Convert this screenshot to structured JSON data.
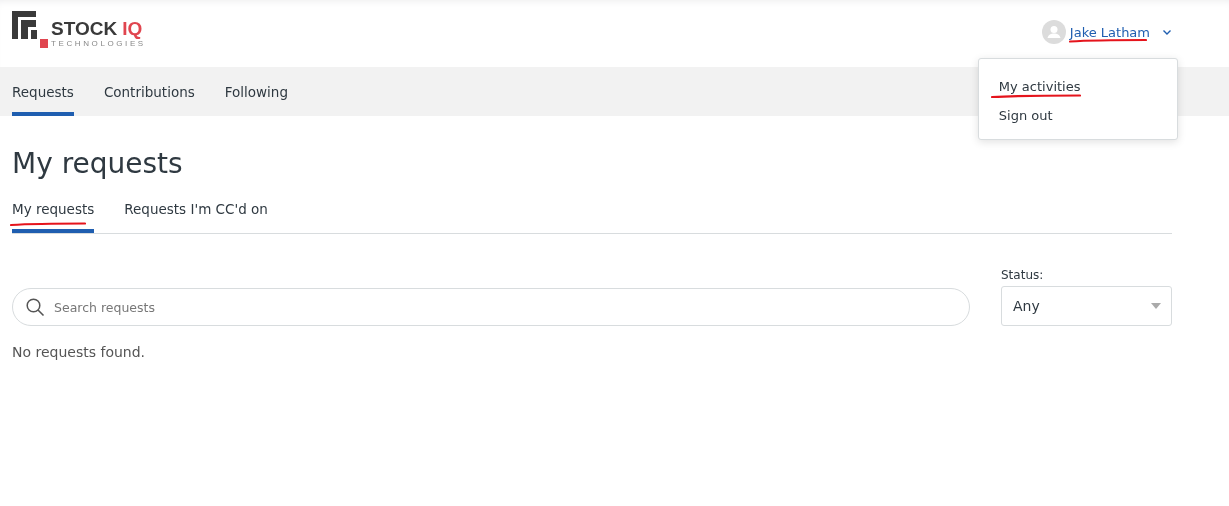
{
  "logo": {
    "name": "STOCK",
    "accent": "IQ",
    "tagline": "TECHNOLOGIES"
  },
  "user": {
    "name": "Jake Latham",
    "annotated": true
  },
  "user_menu": {
    "expanded": true,
    "items": [
      {
        "label": "My activities",
        "annotated": true
      },
      {
        "label": "Sign out",
        "annotated": false
      }
    ]
  },
  "nav_tabs": [
    {
      "label": "Requests",
      "selected": true
    },
    {
      "label": "Contributions",
      "selected": false
    },
    {
      "label": "Following",
      "selected": false
    }
  ],
  "page_title": "My requests",
  "sub_tabs": [
    {
      "label": "My requests",
      "selected": true,
      "annotated": true
    },
    {
      "label": "Requests I'm CC'd on",
      "selected": false,
      "annotated": false
    }
  ],
  "search": {
    "placeholder": "Search requests"
  },
  "status_filter": {
    "label": "Status:",
    "value": "Any"
  },
  "empty_message": "No requests found."
}
